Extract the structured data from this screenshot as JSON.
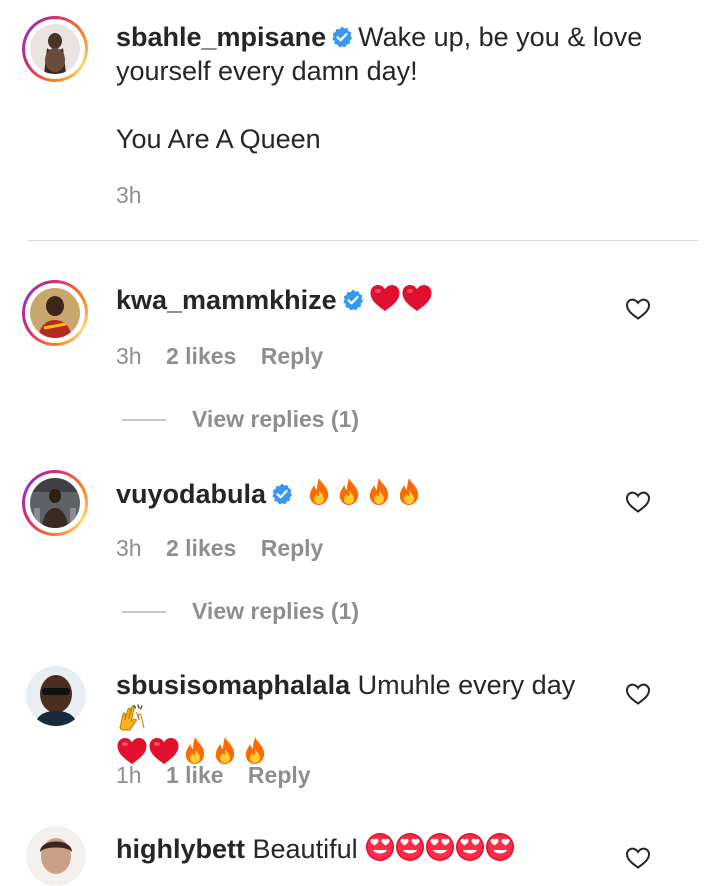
{
  "caption": {
    "username": "sbahle_mpisane",
    "text_line1": "Wake up, be you & love",
    "text_line2": "yourself every damn day!",
    "text_line3": "You Are A Queen",
    "time": "3h",
    "verified_icon": "verified-badge-icon"
  },
  "comments": [
    {
      "username": "kwa_mammkhize",
      "verified": true,
      "emojis": [
        "red-heart",
        "red-heart"
      ],
      "time": "3h",
      "likes": "2 likes",
      "reply": "Reply",
      "view_replies": "View replies (1)"
    },
    {
      "username": "vuyodabula",
      "verified": true,
      "emojis": [
        "fire",
        "fire",
        "fire",
        "fire"
      ],
      "time": "3h",
      "likes": "2 likes",
      "reply": "Reply",
      "view_replies": "View replies (1)"
    },
    {
      "username": "sbusisomaphalala",
      "verified": false,
      "text": "Umuhle every day",
      "emojis": [
        "raising-hands",
        "red-heart",
        "red-heart",
        "fire",
        "fire",
        "fire"
      ],
      "time": "1h",
      "likes": "1 like",
      "reply": "Reply"
    },
    {
      "username": "highlybett",
      "verified": false,
      "text": "Beautiful",
      "emojis": [
        "heart-eyes",
        "heart-eyes",
        "heart-eyes",
        "heart-eyes",
        "heart-eyes"
      ]
    }
  ],
  "colors": {
    "text": "#262626",
    "meta": "#8e8e8e",
    "verified": "#3897f0",
    "divider": "#dbdbdb",
    "heart_emoji": "#e0102e",
    "fire_outer": "#ff6a00",
    "fire_inner": "#ffcc33"
  }
}
